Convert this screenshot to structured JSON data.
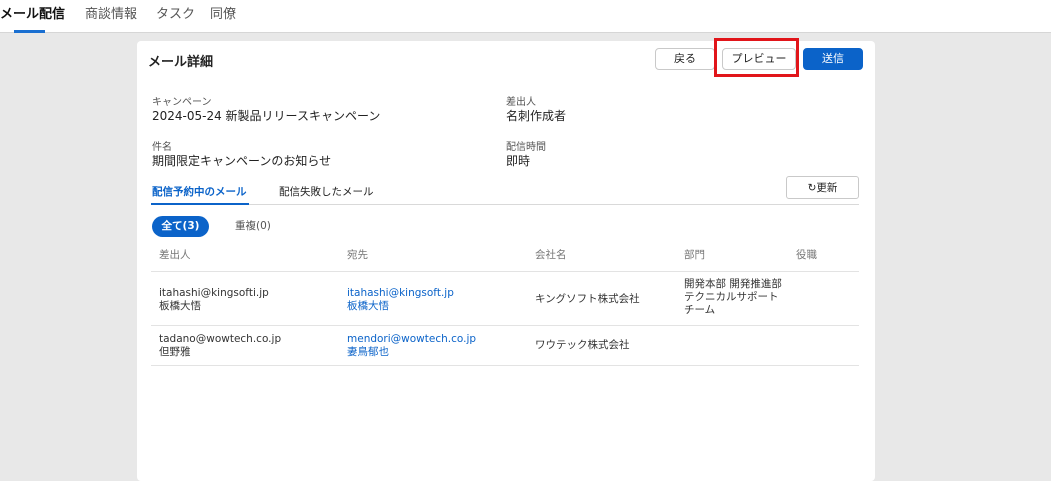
{
  "nav": {
    "tabs": [
      "メール配信",
      "商談情報",
      "タスク",
      "同僚"
    ]
  },
  "card": {
    "title": "メール詳細",
    "buttons": {
      "back": "戻る",
      "preview": "プレビュー",
      "send": "送信"
    }
  },
  "fields": {
    "campaign_label": "キャンペーン",
    "campaign_value": "2024-05-24 新製品リリースキャンペーン",
    "sender_label": "差出人",
    "sender_value": "名刺作成者",
    "subject_label": "件名",
    "subject_value": "期間限定キャンペーンのお知らせ",
    "time_label": "配信時間",
    "time_value": "即時"
  },
  "subtabs": {
    "scheduled": "配信予約中のメール",
    "failed": "配信失敗したメール",
    "refresh": "更新"
  },
  "filters": {
    "all": "全て(3)",
    "duplicate_prefix": "重複",
    "duplicate_count": "(0)"
  },
  "table": {
    "headers": [
      "差出人",
      "宛先",
      "会社名",
      "部門",
      "役職"
    ],
    "rows": [
      {
        "sender_email": "itahashi@kingsofti.jp",
        "sender_name": "板橋大悟",
        "to_email": "itahashi@kingsoft.jp",
        "to_name": "板橋大悟",
        "company": "キングソフト株式会社",
        "department": "開発本部 開発推進部 テクニカルサポートチーム",
        "position": ""
      },
      {
        "sender_email": "tadano@wowtech.co.jp",
        "sender_name": "但野雅",
        "to_email": "mendori@wowtech.co.jp",
        "to_name": "妻鳥郁也",
        "company": "ワウテック株式会社",
        "department": "",
        "position": ""
      }
    ]
  },
  "colors": {
    "accent": "#0b63c9",
    "highlight": "#e1151a"
  }
}
